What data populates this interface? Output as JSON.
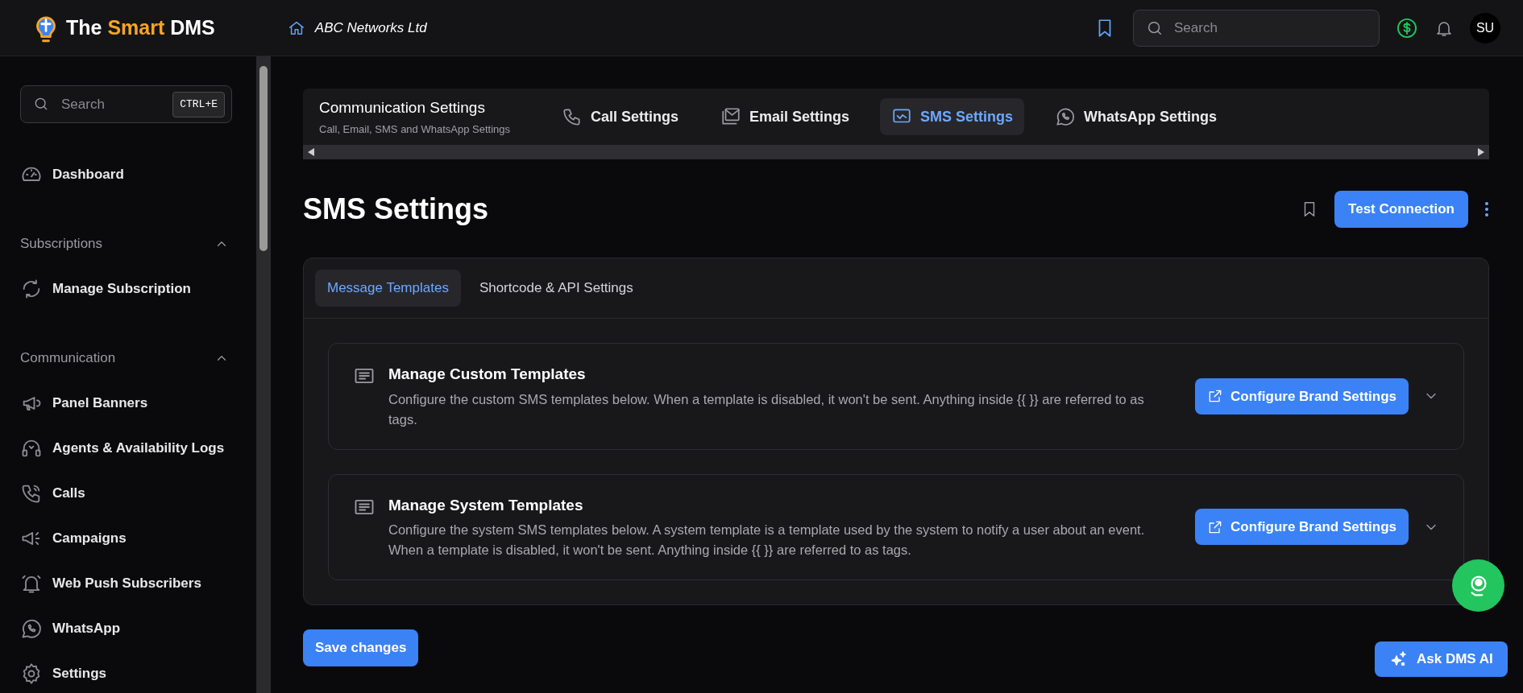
{
  "topbar": {
    "logo": {
      "prefix": "The",
      "highlight": "Smart",
      "suffix": "DMS"
    },
    "company": "ABC Networks Ltd",
    "search": {
      "placeholder": "Search"
    },
    "avatar": "SU"
  },
  "sidebar": {
    "search": {
      "placeholder": "Search",
      "shortcut": "CTRL+E"
    },
    "items": [
      {
        "kind": "link",
        "label": "Dashboard"
      },
      {
        "kind": "section",
        "label": "Subscriptions",
        "expanded": true,
        "children": [
          {
            "label": "Manage Subscription"
          }
        ]
      },
      {
        "kind": "section",
        "label": "Communication",
        "expanded": true,
        "children": [
          {
            "label": "Panel Banners"
          },
          {
            "label": "Agents & Availability Logs"
          },
          {
            "label": "Calls"
          },
          {
            "label": "Campaigns"
          },
          {
            "label": "Web Push Subscribers"
          },
          {
            "label": "WhatsApp"
          },
          {
            "label": "Settings"
          }
        ]
      }
    ]
  },
  "settings_nav": {
    "title": "Communication Settings",
    "subtitle": "Call, Email, SMS and WhatsApp Settings",
    "tabs": [
      {
        "label": "Call Settings",
        "selected": false
      },
      {
        "label": "Email Settings",
        "selected": false
      },
      {
        "label": "SMS Settings",
        "selected": true
      },
      {
        "label": "WhatsApp Settings",
        "selected": false
      }
    ]
  },
  "page": {
    "title": "SMS Settings",
    "primary_button": "Test Connection"
  },
  "subtabs": [
    {
      "label": "Message Templates",
      "selected": true
    },
    {
      "label": "Shortcode & API Settings",
      "selected": false
    }
  ],
  "sections": [
    {
      "title": "Manage Custom Templates",
      "description": "Configure the custom SMS templates below. When a template is disabled, it won't be sent. Anything inside {{ }} are referred to as tags.",
      "button": "Configure Brand Settings",
      "expanded": false
    },
    {
      "title": "Manage System Templates",
      "description": "Configure the system SMS templates below. A system template is a template used by the system to notify a user about an event. When a template is disabled, it won't be sent. Anything inside {{ }} are referred to as tags.",
      "button": "Configure Brand Settings",
      "expanded": false
    }
  ],
  "save_button": "Save changes",
  "ai_button": "Ask DMS AI"
}
